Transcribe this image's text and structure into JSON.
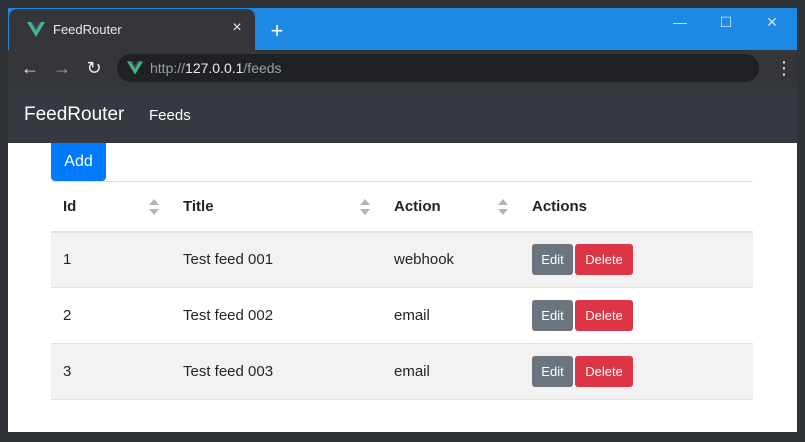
{
  "browser": {
    "tab_title": "FeedRouter",
    "tab_close": "×",
    "new_tab": "+",
    "url_scheme": "http://",
    "url_host": "127.0.0.1",
    "url_path": "/feeds",
    "window_controls": {
      "minimize": "—",
      "maximize": "☐",
      "close": "✕"
    },
    "nav": {
      "back": "←",
      "forward": "→",
      "reload": "↻",
      "menu": "⋮"
    }
  },
  "navbar": {
    "brand": "FeedRouter",
    "links": [
      {
        "label": "Feeds"
      }
    ]
  },
  "main": {
    "add_label": "Add",
    "table": {
      "headers": [
        "Id",
        "Title",
        "Action",
        "Actions"
      ],
      "rows": [
        {
          "id": "1",
          "title": "Test feed 001",
          "action": "webhook",
          "edit": "Edit",
          "delete": "Delete"
        },
        {
          "id": "2",
          "title": "Test feed 002",
          "action": "email",
          "edit": "Edit",
          "delete": "Delete"
        },
        {
          "id": "3",
          "title": "Test feed 003",
          "action": "email",
          "edit": "Edit",
          "delete": "Delete"
        }
      ]
    }
  },
  "colors": {
    "titlebar": "#1e88e5",
    "navbar": "#343a40",
    "primary": "#007bff",
    "secondary": "#6c757d",
    "danger": "#dc3545",
    "vue_green": "#41b883"
  }
}
